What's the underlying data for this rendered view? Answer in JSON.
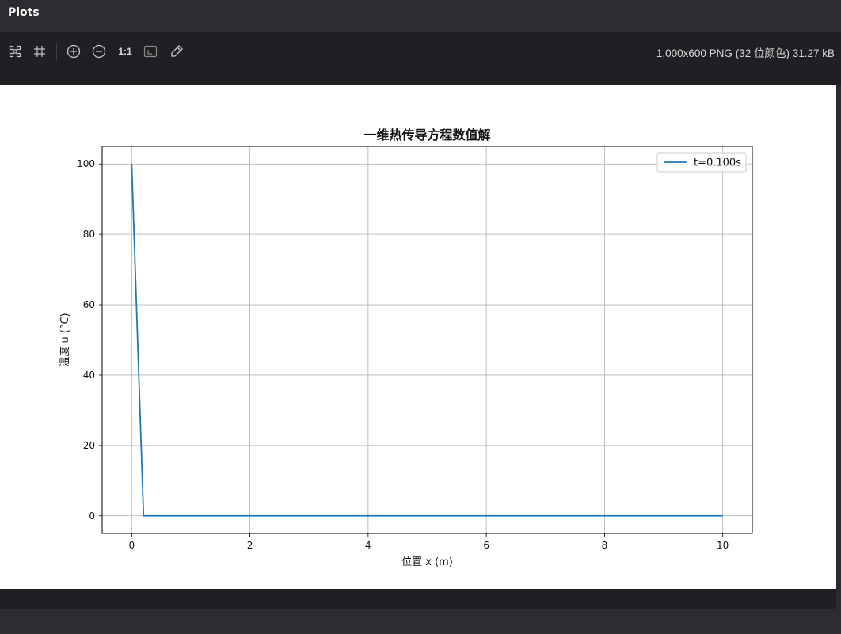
{
  "panel": {
    "title": "Plots"
  },
  "toolbar": {
    "items": [
      {
        "name": "fit-icon"
      },
      {
        "name": "crop-icon"
      },
      {
        "name": "zoom-in-icon"
      },
      {
        "name": "zoom-out-icon"
      },
      {
        "name": "actual-size",
        "label": "1:1"
      },
      {
        "name": "background-icon"
      },
      {
        "name": "color-picker-icon"
      }
    ],
    "image_info": "1,000x600 PNG (32 位颜色) 31.27 kB"
  },
  "colors": {
    "panel_bg": "#2b2c30",
    "toolbar_bg": "#1f2023",
    "line": "#1f77b4",
    "grid": "#b0b0b0"
  },
  "chart_data": {
    "type": "line",
    "title": "一维热传导方程数值解",
    "xlabel": "位置 x (m)",
    "ylabel": "温度 u (°C)",
    "xlim": [
      -0.5,
      10.5
    ],
    "ylim": [
      -5,
      105
    ],
    "xticks": [
      0,
      2,
      4,
      6,
      8,
      10
    ],
    "yticks": [
      0,
      20,
      40,
      60,
      80,
      100
    ],
    "grid": true,
    "legend_position": "top-right",
    "series": [
      {
        "name": "t=0.100s",
        "color": "#1f77b4",
        "x": [
          0,
          0.2,
          10
        ],
        "y": [
          100,
          0,
          0
        ]
      }
    ]
  }
}
